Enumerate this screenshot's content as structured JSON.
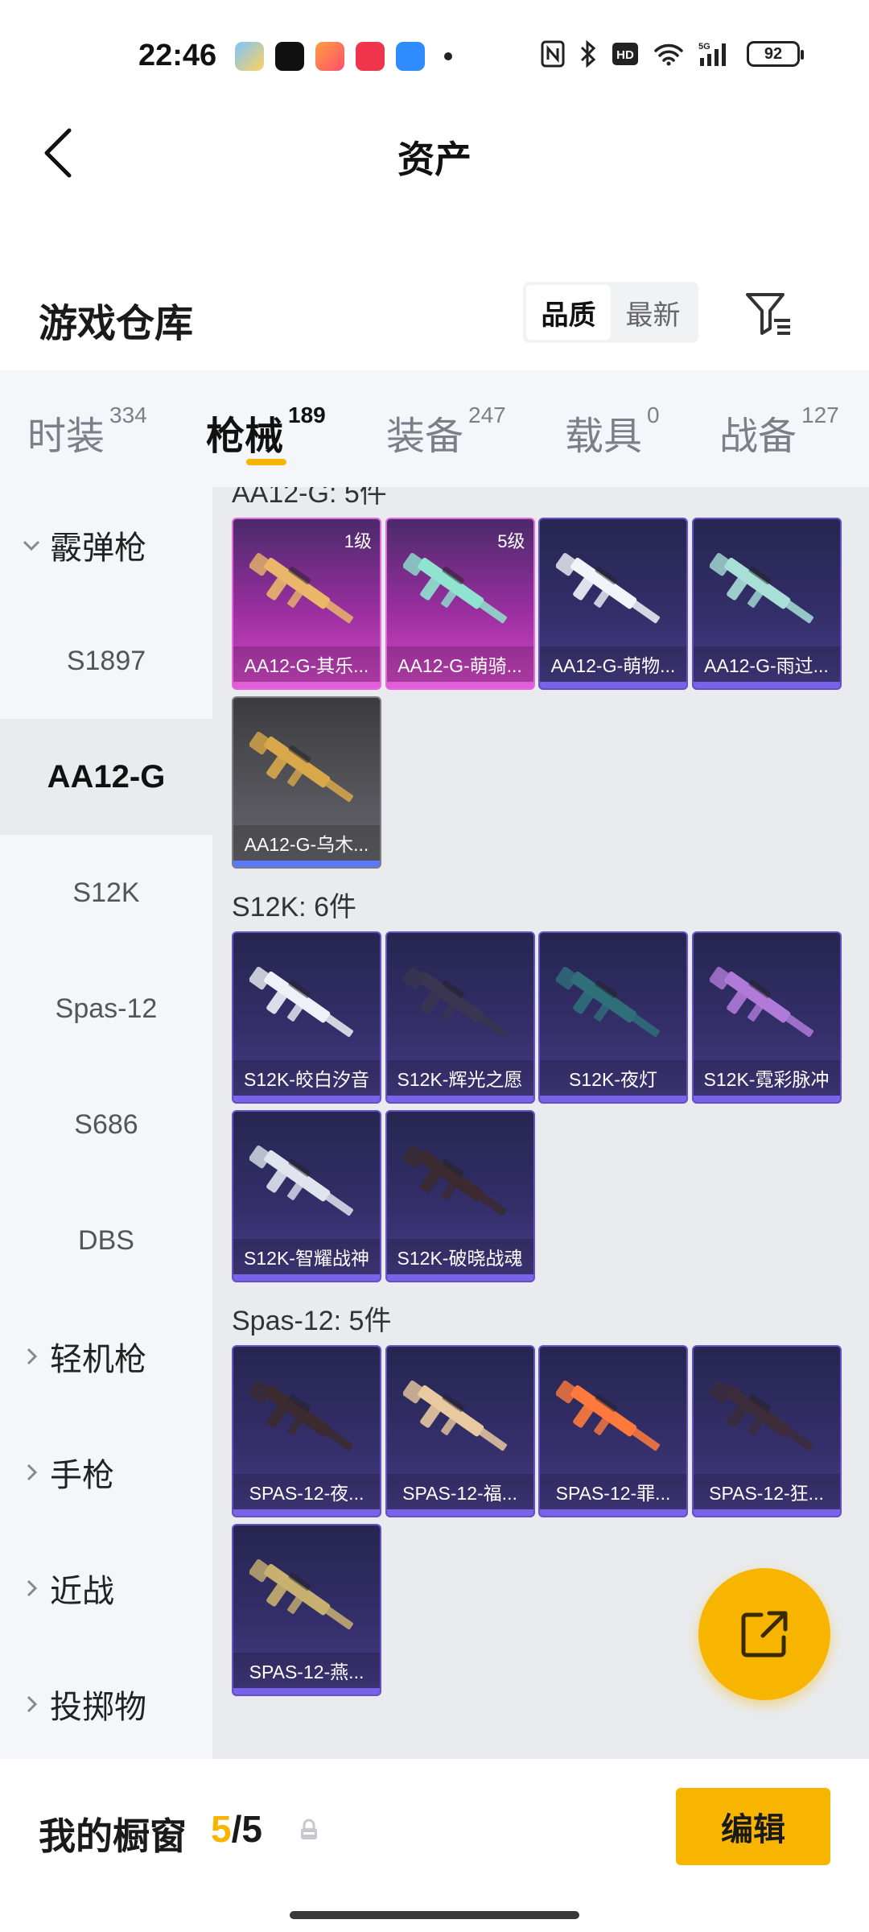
{
  "status_bar": {
    "time": "22:46",
    "battery": "92"
  },
  "nav": {
    "title": "资产"
  },
  "section": {
    "title": "游戏仓库",
    "sort_quality": "品质",
    "sort_newest": "最新"
  },
  "tabs": [
    {
      "label": "时装",
      "count": "334"
    },
    {
      "label": "枪械",
      "count": "189"
    },
    {
      "label": "装备",
      "count": "247"
    },
    {
      "label": "载具",
      "count": "0"
    },
    {
      "label": "战备",
      "count": "127"
    }
  ],
  "sidebar": {
    "groups": [
      {
        "label": "霰弹枪"
      },
      {
        "label": "轻机枪"
      },
      {
        "label": "手枪"
      },
      {
        "label": "近战"
      },
      {
        "label": "投掷物"
      }
    ],
    "items": [
      "S1897",
      "AA12-G",
      "S12K",
      "Spas-12",
      "S686",
      "DBS"
    ]
  },
  "content": {
    "groups": [
      {
        "heading": "AA12-G: 5件",
        "cards": [
          {
            "name": "AA12-G-其乐...",
            "level": "1级",
            "rarity": "pink"
          },
          {
            "name": "AA12-G-萌骑...",
            "level": "5级",
            "rarity": "pink"
          },
          {
            "name": "AA12-G-萌物...",
            "level": "",
            "rarity": "purple"
          },
          {
            "name": "AA12-G-雨过...",
            "level": "",
            "rarity": "purple"
          },
          {
            "name": "AA12-G-乌木...",
            "level": "",
            "rarity": "gray"
          }
        ]
      },
      {
        "heading": "S12K: 6件",
        "cards": [
          {
            "name": "S12K-皎白汐音",
            "level": "",
            "rarity": "purple"
          },
          {
            "name": "S12K-辉光之愿",
            "level": "",
            "rarity": "purple"
          },
          {
            "name": "S12K-夜灯",
            "level": "",
            "rarity": "purple"
          },
          {
            "name": "S12K-霓彩脉冲",
            "level": "",
            "rarity": "purple"
          },
          {
            "name": "S12K-智耀战神",
            "level": "",
            "rarity": "purple"
          },
          {
            "name": "S12K-破晓战魂",
            "level": "",
            "rarity": "purple"
          }
        ]
      },
      {
        "heading": "Spas-12: 5件",
        "cards": [
          {
            "name": "SPAS-12-夜...",
            "level": "",
            "rarity": "purple"
          },
          {
            "name": "SPAS-12-福...",
            "level": "",
            "rarity": "purple"
          },
          {
            "name": "SPAS-12-罪...",
            "level": "",
            "rarity": "purple"
          },
          {
            "name": "SPAS-12-狂...",
            "level": "",
            "rarity": "purple"
          },
          {
            "name": "SPAS-12-燕...",
            "level": "",
            "rarity": "purple"
          }
        ]
      }
    ]
  },
  "bottom": {
    "showcase_label": "我的橱窗",
    "showcase_current": "5",
    "showcase_sep": "/",
    "showcase_total": "5",
    "edit_label": "编辑"
  },
  "colors": {
    "accent": "#f7b500",
    "pink_rarity": "#d449c6",
    "purple_rarity": "#4a3f8a",
    "gray_rarity": "#65656b"
  }
}
